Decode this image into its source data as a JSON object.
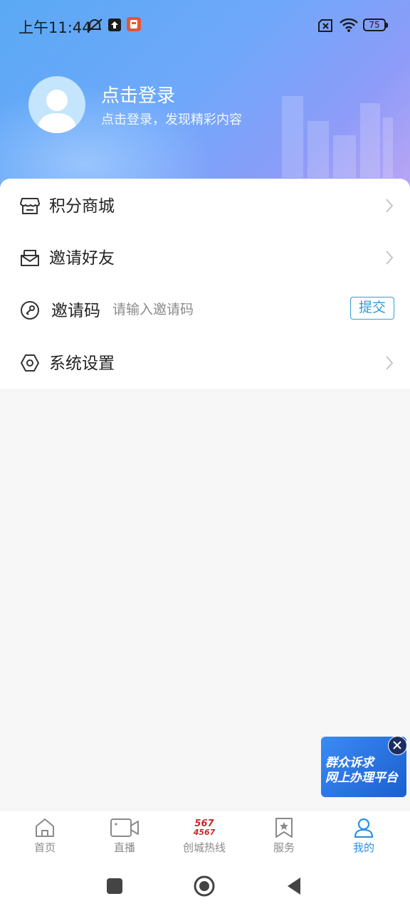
{
  "status_bar": {
    "time": "上午11:44",
    "battery": "75",
    "icons": [
      "mute-bell-icon",
      "upload-icon",
      "app-notification-icon",
      "sim-off-icon",
      "wifi-icon",
      "battery-icon"
    ]
  },
  "profile": {
    "title": "点击登录",
    "subtitle": "点击登录，发现精彩内容"
  },
  "menu": {
    "points_mall": "积分商城",
    "invite_friends": "邀请好友",
    "invite_code": {
      "label": "邀请码",
      "placeholder": "请输入邀请码",
      "submit": "提交"
    },
    "settings": "系统设置"
  },
  "float_banner": {
    "line1": "群众诉求",
    "line2": "网上办理平台"
  },
  "tabbar": {
    "tabs": [
      {
        "label": "首页",
        "icon": "home-icon"
      },
      {
        "label": "直播",
        "icon": "video-camera-icon"
      },
      {
        "label": "创城热线",
        "icon": "hotline-icon",
        "badge_top": "567",
        "badge_bottom": "4567"
      },
      {
        "label": "服务",
        "icon": "bookmark-star-icon"
      },
      {
        "label": "我的",
        "icon": "user-icon"
      }
    ],
    "active_index": 4
  },
  "colors": {
    "accent": "#2a8fe8",
    "submit_border": "#33a0d8",
    "header_start": "#5aa9f5",
    "header_end": "#c1a6f4"
  }
}
